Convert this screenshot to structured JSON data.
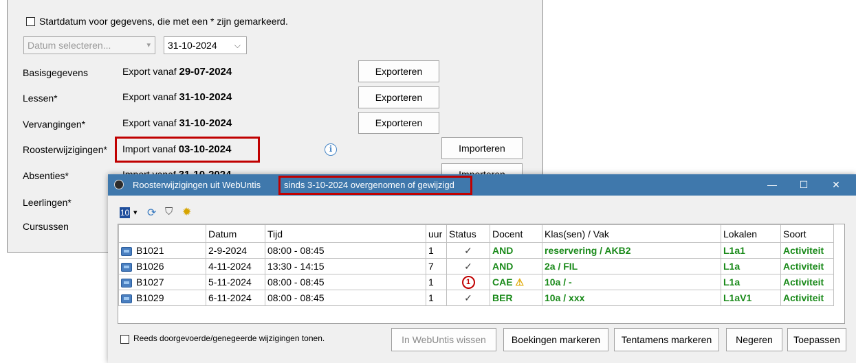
{
  "background_panel": {
    "startdate_checkbox_label": "Startdatum voor gegevens, die met een * zijn gemarkeerd.",
    "date_select_placeholder": "Datum selecteren...",
    "date_value": "31-10-2024",
    "rows": [
      {
        "label": "Basisgegevens",
        "prefix": "Export vanaf ",
        "date": "29-07-2024",
        "button": "Exporteren"
      },
      {
        "label": "Lessen*",
        "prefix": "Export vanaf ",
        "date": "31-10-2024",
        "button": "Exporteren"
      },
      {
        "label": "Vervangingen*",
        "prefix": "Export vanaf ",
        "date": "31-10-2024",
        "button": "Exporteren"
      },
      {
        "label": "Roosterwijzigingen*",
        "prefix": "Import vanaf ",
        "date": "03-10-2024",
        "button": "Importeren"
      },
      {
        "label": "Absenties*",
        "prefix": "Import vanaf ",
        "date": "31-10-2024",
        "button": "Importeren"
      },
      {
        "label": "Leerlingen*"
      },
      {
        "label": "Cursussen"
      }
    ]
  },
  "dialog": {
    "title": "Roosterwijzigingen uit WebUntis",
    "title_highlight": "sinds 3-10-2024 overgenomen of gewijzigd",
    "toolbar_count": "10",
    "columns": [
      "",
      "Datum",
      "Tijd",
      "uur",
      "Status",
      "Docent",
      "Klas(sen) / Vak",
      "Lokalen",
      "Soort"
    ],
    "rows": [
      {
        "id": "B1021",
        "datum": "2-9-2024",
        "tijd": "08:00 - 08:45",
        "uur": "1",
        "status": "✓",
        "docent": "AND",
        "klas": "reservering / AKB2",
        "lokalen": "L1a1",
        "soort": "Activiteit"
      },
      {
        "id": "B1026",
        "datum": "4-11-2024",
        "tijd": "13:30 - 14:15",
        "uur": "7",
        "status": "✓",
        "docent": "AND",
        "klas": "2a / FIL",
        "lokalen": "L1a",
        "soort": "Activiteit"
      },
      {
        "id": "B1027",
        "datum": "5-11-2024",
        "tijd": "08:00 - 08:45",
        "uur": "1",
        "status": "1",
        "docent": "CAE",
        "klas": "10a / -",
        "lokalen": "L1a",
        "soort": "Activiteit"
      },
      {
        "id": "B1029",
        "datum": "6-11-2024",
        "tijd": "08:00 - 08:45",
        "uur": "1",
        "status": "✓",
        "docent": "BER",
        "klas": "10a / xxx",
        "lokalen": "L1aV1",
        "soort": "Activiteit"
      }
    ],
    "show_done_label": "Reeds doorgevoerde/genegeerde wijzigingen tonen.",
    "buttons": {
      "delete": "In WebUntis wissen",
      "mark_bookings": "Boekingen markeren",
      "mark_exams": "Tentamens markeren",
      "ignore": "Negeren",
      "apply": "Toepassen"
    }
  },
  "colors": {
    "titlebar": "#3f78ac",
    "highlight_red": "#c00000",
    "green_text": "#1a8a1a"
  }
}
